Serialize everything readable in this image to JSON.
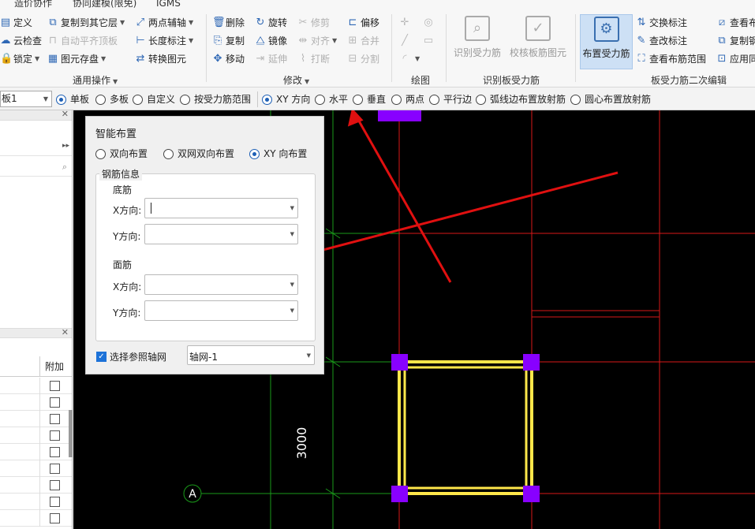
{
  "menubar": {
    "items": [
      "造价协作",
      "协同建模(限免)",
      "IGMS"
    ]
  },
  "ribbon": {
    "col1": [
      "定义",
      "云检查",
      "锁定"
    ],
    "col2": [
      "复制到其它层",
      "自动平齐顶板",
      "图元存盘"
    ],
    "col3": [
      "两点辅轴",
      "长度标注",
      "转换图元"
    ],
    "group1": "通用操作",
    "mod_col1": [
      "删除",
      "复制",
      "移动"
    ],
    "mod_col2": [
      "旋转",
      "镜像",
      "延伸"
    ],
    "mod_col3": [
      "修剪",
      "对齐",
      "打断"
    ],
    "mod_col4": [
      "偏移",
      "合并",
      "分割"
    ],
    "group2": "修改",
    "group3": "绘图",
    "recog1": "识别受力筋",
    "recog2": "校核板筋图元",
    "group4": "识别板受力筋",
    "place_btn": "布置受力筋",
    "edit_col1": [
      "交换标注",
      "查改标注",
      "查看布筋范围"
    ],
    "edit_col2": [
      "查看布",
      "复制钢",
      "应用同"
    ],
    "group5": "板受力筋二次编辑"
  },
  "optbar": {
    "board_select": "板1",
    "options": [
      "单板",
      "多板",
      "自定义",
      "按受力筋范围",
      "XY 方向",
      "水平",
      "垂直",
      "两点",
      "平行边",
      "弧线边布置放射筋",
      "圆心布置放射筋"
    ]
  },
  "leftpanel": {
    "col_header": "附加"
  },
  "dialog": {
    "title": "智能布置",
    "modes": [
      "双向布置",
      "双网双向布置",
      "XY 向布置"
    ],
    "group_title": "钢筋信息",
    "bottom_title": "底筋",
    "top_title": "面筋",
    "x_label": "X方向:",
    "y_label": "Y方向:",
    "ref_axis_label": "选择参照轴网",
    "ref_axis_value": "轴网-1"
  },
  "canvas": {
    "dimension": "3000",
    "axis_label": "A"
  },
  "colors": {
    "accent": "#1d5fb5",
    "grid_red": "#d81818",
    "grid_green": "#1a9a1a",
    "column": "#8800ff",
    "beam": "#ffe74a"
  }
}
